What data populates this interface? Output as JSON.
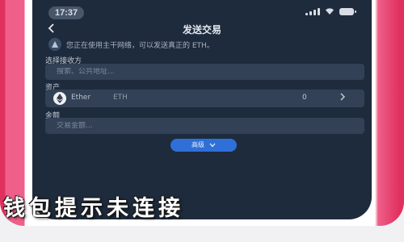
{
  "status_bar": {
    "time": "17:37"
  },
  "header": {
    "back_icon": "chevron-left-icon",
    "title": "发送交易"
  },
  "notice": {
    "icon": "info-icon",
    "text": "您正在使用主干网络，可以发送真正的 ETH。"
  },
  "network": {
    "label": "选择接收方",
    "placeholder": "搜索、公共地址..."
  },
  "asset": {
    "label": "资产",
    "name": "Ether",
    "symbol": "ETH",
    "balance": "0",
    "icon": "ethereum-icon"
  },
  "amount": {
    "label": "金额",
    "placeholder": "交易金额..."
  },
  "advanced_button": {
    "label": "高级",
    "icon": "chevron-down-icon"
  },
  "caption": "钱包提示未连接",
  "colors": {
    "screen_bg": "#1e2b3c",
    "field_bg": "#324155",
    "accent": "#2f6fd8",
    "frame": "#ef5f8a"
  }
}
